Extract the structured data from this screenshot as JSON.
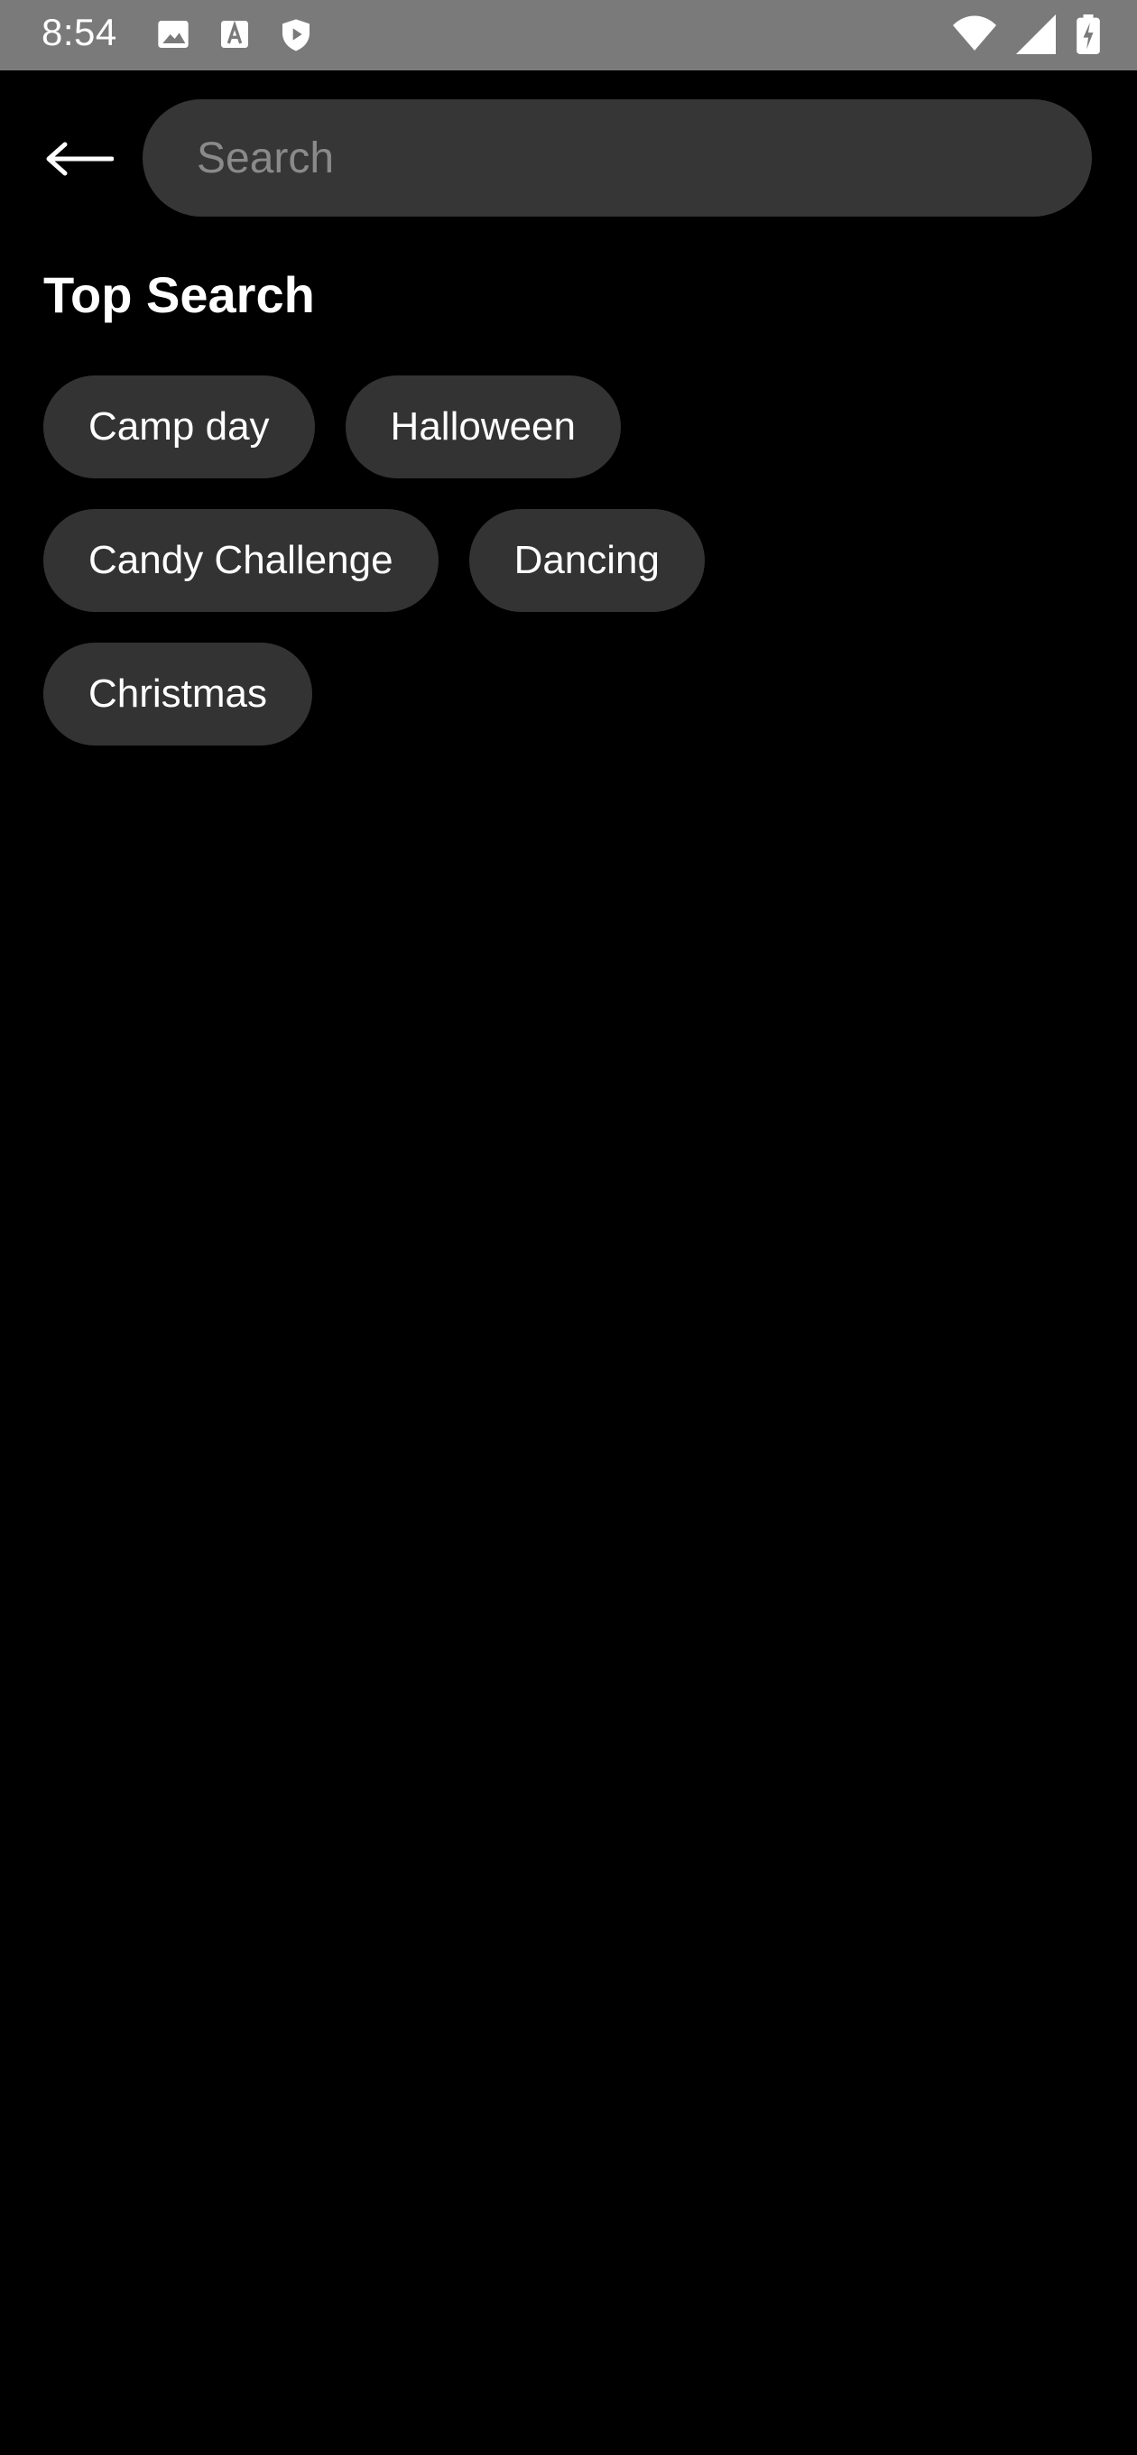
{
  "status_bar": {
    "time": "8:54",
    "left_icons": [
      "image-icon",
      "font-download-icon",
      "shield-play-icon"
    ],
    "right_icons": [
      "wifi-icon",
      "cellular-signal-icon",
      "battery-charging-icon"
    ],
    "background_color": "#7a7a7a"
  },
  "search": {
    "placeholder": "Search",
    "value": "",
    "back_icon": "arrow-back-icon"
  },
  "top_search": {
    "title": "Top Search",
    "rows": [
      [
        "Camp day",
        "Halloween"
      ],
      [
        "Candy Challenge",
        "Dancing"
      ],
      [
        "Christmas"
      ]
    ]
  },
  "colors": {
    "background": "#000000",
    "chip": "#333333",
    "search_box": "#363636",
    "placeholder": "#8a8a8a",
    "text": "#ffffff"
  }
}
